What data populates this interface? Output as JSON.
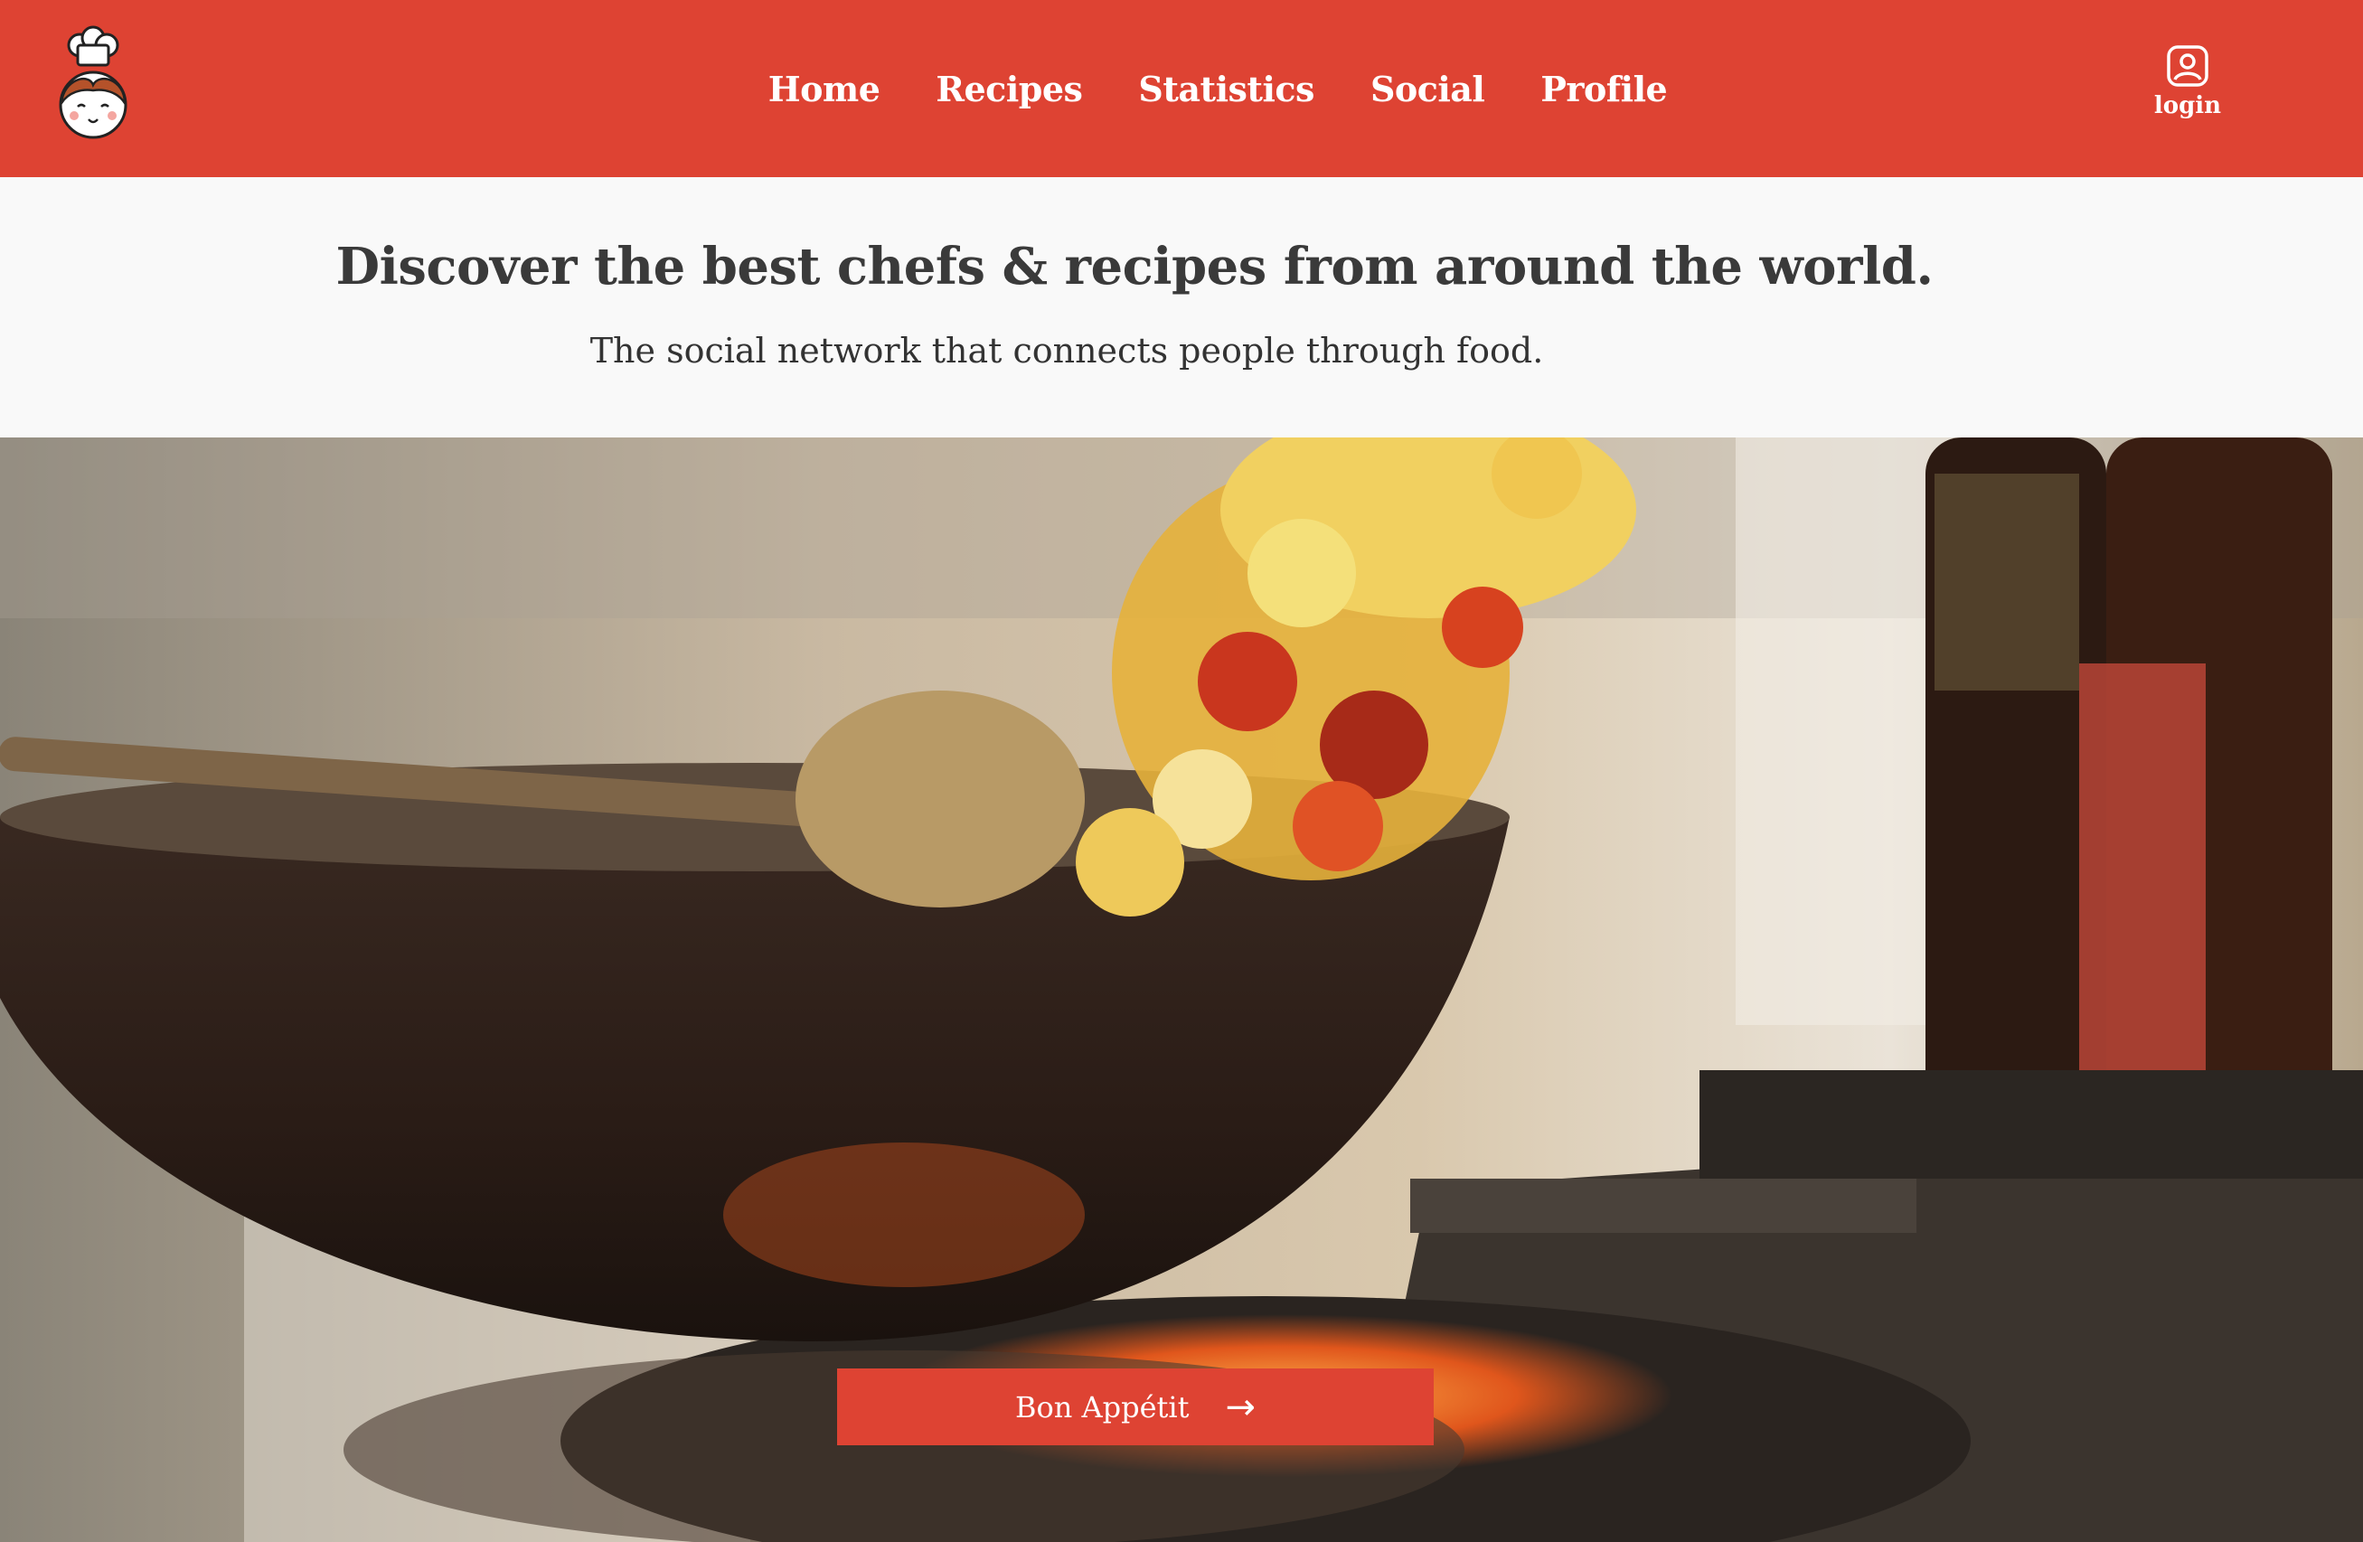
{
  "header": {
    "logo_icon": "chef-girl-logo-icon",
    "nav": [
      {
        "label": "Home"
      },
      {
        "label": "Recipes"
      },
      {
        "label": "Statistics"
      },
      {
        "label": "Social"
      },
      {
        "label": "Profile"
      }
    ],
    "login": {
      "label": "login",
      "icon": "user-profile-icon"
    }
  },
  "hero": {
    "headline": "Discover the best chefs & recipes from around the world.",
    "subline": "The social network that connects people through food."
  },
  "cta": {
    "label": "Bon Appétit",
    "icon": "arrow-right-icon"
  },
  "colors": {
    "brand": "#de4333",
    "background": "#f9f9f9",
    "text": "#3a3a3a"
  }
}
